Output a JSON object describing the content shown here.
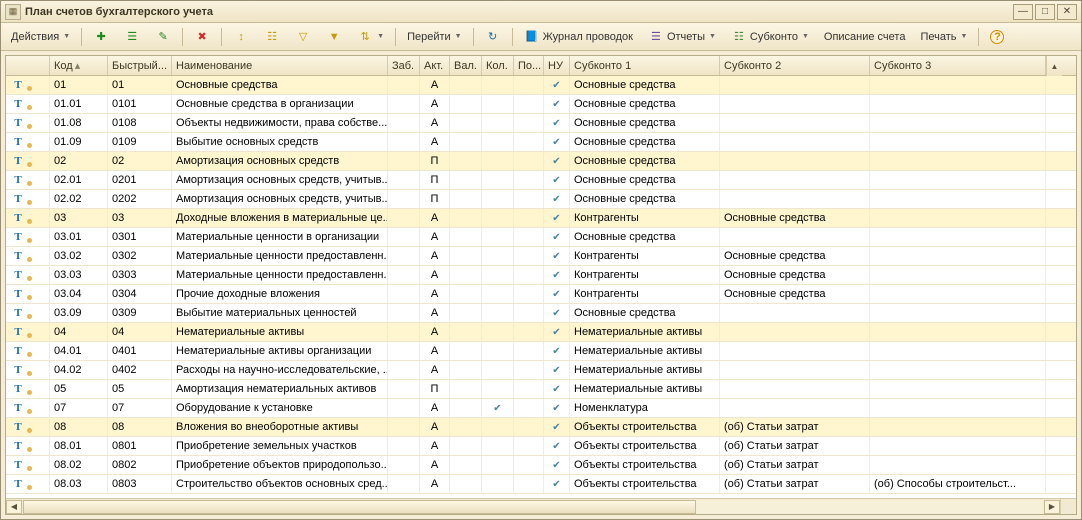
{
  "window": {
    "title": "План счетов бухгалтерского учета"
  },
  "toolbar": {
    "actions": "Действия",
    "go": "Перейти",
    "journal": "Журнал проводок",
    "reports": "Отчеты",
    "subkonto": "Субконто",
    "desc": "Описание счета",
    "print": "Печать"
  },
  "columns": [
    "",
    "Код",
    "Быстрый...",
    "Наименование",
    "Заб.",
    "Акт.",
    "Вал.",
    "Кол.",
    "По...",
    "НУ",
    "Субконто 1",
    "Субконто 2",
    "Субконто 3"
  ],
  "rows": [
    {
      "hl": 1,
      "code": "01",
      "fast": "01",
      "name": "Основные средства",
      "akt": "А",
      "nu": 1,
      "s1": "Основные средства"
    },
    {
      "code": "01.01",
      "fast": "0101",
      "name": "Основные средства в организации",
      "akt": "А",
      "nu": 1,
      "s1": "Основные средства"
    },
    {
      "code": "01.08",
      "fast": "0108",
      "name": "Объекты недвижимости, права собстве...",
      "akt": "А",
      "nu": 1,
      "s1": "Основные средства"
    },
    {
      "code": "01.09",
      "fast": "0109",
      "name": "Выбытие основных средств",
      "akt": "А",
      "nu": 1,
      "s1": "Основные средства"
    },
    {
      "hl": 1,
      "code": "02",
      "fast": "02",
      "name": "Амортизация основных средств",
      "akt": "П",
      "nu": 1,
      "s1": "Основные средства"
    },
    {
      "code": "02.01",
      "fast": "0201",
      "name": "Амортизация основных средств, учитыв...",
      "akt": "П",
      "nu": 1,
      "s1": "Основные средства"
    },
    {
      "code": "02.02",
      "fast": "0202",
      "name": "Амортизация основных средств, учитыв...",
      "akt": "П",
      "nu": 1,
      "s1": "Основные средства"
    },
    {
      "hl": 1,
      "code": "03",
      "fast": "03",
      "name": "Доходные вложения в материальные це...",
      "akt": "А",
      "nu": 1,
      "s1": "Контрагенты",
      "s2": "Основные средства"
    },
    {
      "code": "03.01",
      "fast": "0301",
      "name": "Материальные ценности в организации",
      "akt": "А",
      "nu": 1,
      "s1": "Основные средства"
    },
    {
      "code": "03.02",
      "fast": "0302",
      "name": "Материальные ценности предоставленн...",
      "akt": "А",
      "nu": 1,
      "s1": "Контрагенты",
      "s2": "Основные средства"
    },
    {
      "code": "03.03",
      "fast": "0303",
      "name": "Материальные ценности предоставленн...",
      "akt": "А",
      "nu": 1,
      "s1": "Контрагенты",
      "s2": "Основные средства"
    },
    {
      "code": "03.04",
      "fast": "0304",
      "name": "Прочие доходные вложения",
      "akt": "А",
      "nu": 1,
      "s1": "Контрагенты",
      "s2": "Основные средства"
    },
    {
      "code": "03.09",
      "fast": "0309",
      "name": "Выбытие материальных ценностей",
      "akt": "А",
      "nu": 1,
      "s1": "Основные средства"
    },
    {
      "hl": 1,
      "code": "04",
      "fast": "04",
      "name": "Нематериальные активы",
      "akt": "А",
      "nu": 1,
      "s1": "Нематериальные активы"
    },
    {
      "code": "04.01",
      "fast": "0401",
      "name": "Нематериальные активы организации",
      "akt": "А",
      "nu": 1,
      "s1": "Нематериальные активы"
    },
    {
      "code": "04.02",
      "fast": "0402",
      "name": "Расходы на научно-исследовательские, ...",
      "akt": "А",
      "nu": 1,
      "s1": "Нематериальные активы"
    },
    {
      "code": "05",
      "fast": "05",
      "name": "Амортизация нематериальных активов",
      "akt": "П",
      "nu": 1,
      "s1": "Нематериальные активы"
    },
    {
      "code": "07",
      "fast": "07",
      "name": "Оборудование к установке",
      "akt": "А",
      "kol": 1,
      "nu": 1,
      "s1": "Номенклатура"
    },
    {
      "hl": 1,
      "code": "08",
      "fast": "08",
      "name": "Вложения во внеоборотные активы",
      "akt": "А",
      "nu": 1,
      "s1": "Объекты строительства",
      "s2": "(об) Статьи затрат"
    },
    {
      "code": "08.01",
      "fast": "0801",
      "name": "Приобретение земельных участков",
      "akt": "А",
      "nu": 1,
      "s1": "Объекты строительства",
      "s2": "(об) Статьи затрат"
    },
    {
      "code": "08.02",
      "fast": "0802",
      "name": "Приобретение объектов природопользо...",
      "akt": "А",
      "nu": 1,
      "s1": "Объекты строительства",
      "s2": "(об) Статьи затрат"
    },
    {
      "code": "08.03",
      "fast": "0803",
      "name": "Строительство объектов основных сред...",
      "akt": "А",
      "nu": 1,
      "s1": "Объекты строительства",
      "s2": "(об) Статьи затрат",
      "s3": "(об) Способы строительст..."
    }
  ]
}
